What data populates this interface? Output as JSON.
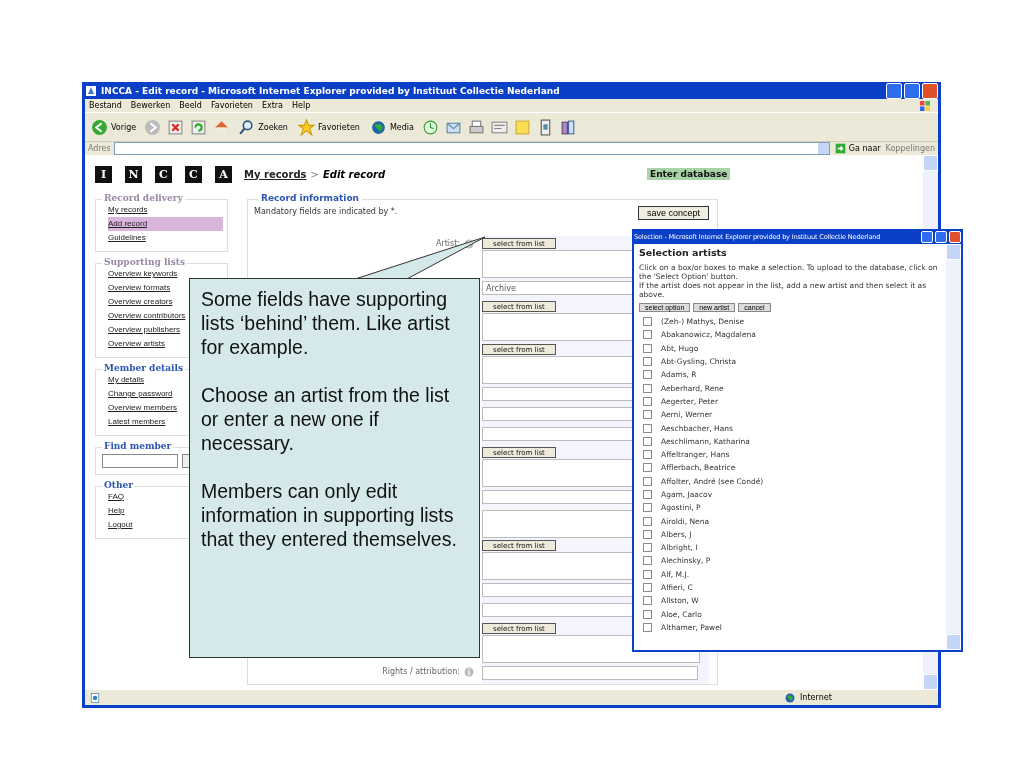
{
  "window": {
    "title": "INCCA - Edit record - Microsoft Internet Explorer provided by Instituut Collectie Nederland"
  },
  "menu": [
    "Bestand",
    "Bewerken",
    "Beeld",
    "Favorieten",
    "Extra",
    "Help"
  ],
  "toolbar": {
    "back": "Vorige",
    "search": "Zoeken",
    "favorites": "Favorieten",
    "media": "Media"
  },
  "address_bar": {
    "label": "Adres",
    "go": "Ga naar",
    "links": "Koppelingen"
  },
  "logo": [
    "I",
    "N",
    "C",
    "C",
    "A"
  ],
  "breadcrumb": {
    "link": "My records",
    "separator": ">",
    "current": "Edit record"
  },
  "enter_database": "Enter database",
  "sidebar": [
    {
      "title": "Record delivery",
      "color": "#9a88a8",
      "items": [
        {
          "label": "My records",
          "selected": false
        },
        {
          "label": "Add record",
          "selected": true
        },
        {
          "label": "Guidelines",
          "selected": false
        }
      ]
    },
    {
      "title": "Supporting lists",
      "color": "#9a88a8",
      "items": [
        {
          "label": "Overview keywords",
          "selected": false
        },
        {
          "label": "Overview formats",
          "selected": false
        },
        {
          "label": "Overview creators",
          "selected": false
        },
        {
          "label": "Overview contributors",
          "selected": false
        },
        {
          "label": "Overview publishers",
          "selected": false
        },
        {
          "label": "Overview artists",
          "selected": false
        }
      ]
    },
    {
      "title": "Member details",
      "color": "#2a55b0",
      "items": [
        {
          "label": "My details",
          "selected": false
        },
        {
          "label": "Change password",
          "selected": false
        },
        {
          "label": "Overview members",
          "selected": false
        },
        {
          "label": "Latest members",
          "selected": false
        }
      ]
    },
    {
      "title": "Find member",
      "color": "#2a55b0",
      "kind": "search"
    },
    {
      "title": "Other",
      "color": "#2a55b0",
      "items": [
        {
          "label": "FAQ",
          "selected": false
        },
        {
          "label": "Help",
          "selected": false
        },
        {
          "label": "Logout",
          "selected": false
        }
      ]
    }
  ],
  "record": {
    "title": "Record information",
    "note": "Mandatory fields are indicated by *.",
    "save": "save concept",
    "fields": [
      {
        "kind": "picker",
        "label": "Artist:",
        "button": "select from list"
      },
      {
        "kind": "text",
        "value": "Archive"
      },
      {
        "kind": "picker",
        "button": "select from list"
      },
      {
        "kind": "picker",
        "button": "select from list"
      },
      {
        "kind": "text"
      },
      {
        "kind": "text"
      },
      {
        "kind": "text"
      },
      {
        "kind": "picker",
        "button": "select from list"
      },
      {
        "kind": "text"
      },
      {
        "kind": "area"
      },
      {
        "kind": "picker",
        "button": "select from list"
      },
      {
        "kind": "text"
      },
      {
        "kind": "text"
      },
      {
        "kind": "picker",
        "button": "select from list"
      },
      {
        "kind": "text",
        "label": "Rights / attribution:"
      }
    ]
  },
  "popup": {
    "title": "Selection - Microsoft Internet Explorer provided by Instituut Collectie Nederland",
    "heading": "Selection artists",
    "instructions": [
      "Click on a box/or boxes to make a selection. To upload to the database, click on the 'Select Option' button.",
      "If the artist does not appear in the list, add a new artist and then select it as above."
    ],
    "buttons": [
      "select option",
      "new artist",
      "cancel"
    ],
    "artists": [
      {
        "name": "(Zeh-) Mathys, Denise",
        "checked": false
      },
      {
        "name": "Abakanowicz, Magdalena",
        "checked": false
      },
      {
        "name": "Abt, Hugo",
        "checked": false
      },
      {
        "name": "Abt-Gysling, Christa",
        "checked": false
      },
      {
        "name": "Adams, R",
        "checked": false
      },
      {
        "name": "Aeberhard, Rene",
        "checked": false
      },
      {
        "name": "Aegerter, Peter",
        "checked": false
      },
      {
        "name": "Aerni, Werner",
        "checked": false
      },
      {
        "name": "Aeschbacher, Hans",
        "checked": false
      },
      {
        "name": "Aeschlimann, Katharina",
        "checked": false
      },
      {
        "name": "Affeltranger, Hans",
        "checked": false
      },
      {
        "name": "Afflerbach, Beatrice",
        "checked": false
      },
      {
        "name": "Affolter, André (see Condé)",
        "checked": false
      },
      {
        "name": "Agam, Jaacov",
        "checked": false
      },
      {
        "name": "Agostini, P",
        "checked": false
      },
      {
        "name": "Airoldi, Nena",
        "checked": false
      },
      {
        "name": "Albers, J",
        "checked": false
      },
      {
        "name": "Albright, I",
        "checked": false
      },
      {
        "name": "Alechinsky, P",
        "checked": false
      },
      {
        "name": "Alf, M.J.",
        "checked": false
      },
      {
        "name": "Alfieri, C",
        "checked": false
      },
      {
        "name": "Allston, W",
        "checked": false
      },
      {
        "name": "Aloe, Carlo",
        "checked": false
      },
      {
        "name": "Althamer, Pawel",
        "checked": false
      }
    ]
  },
  "status_bar": {
    "zone": "Internet"
  },
  "callout": {
    "paragraphs": [
      "Some fields have supporting lists ‘behind’ them. Like artist for example.",
      "Choose an artist from the list or enter a new one if necessary.",
      "Members can only edit information in supporting lists that they entered themselves."
    ]
  }
}
